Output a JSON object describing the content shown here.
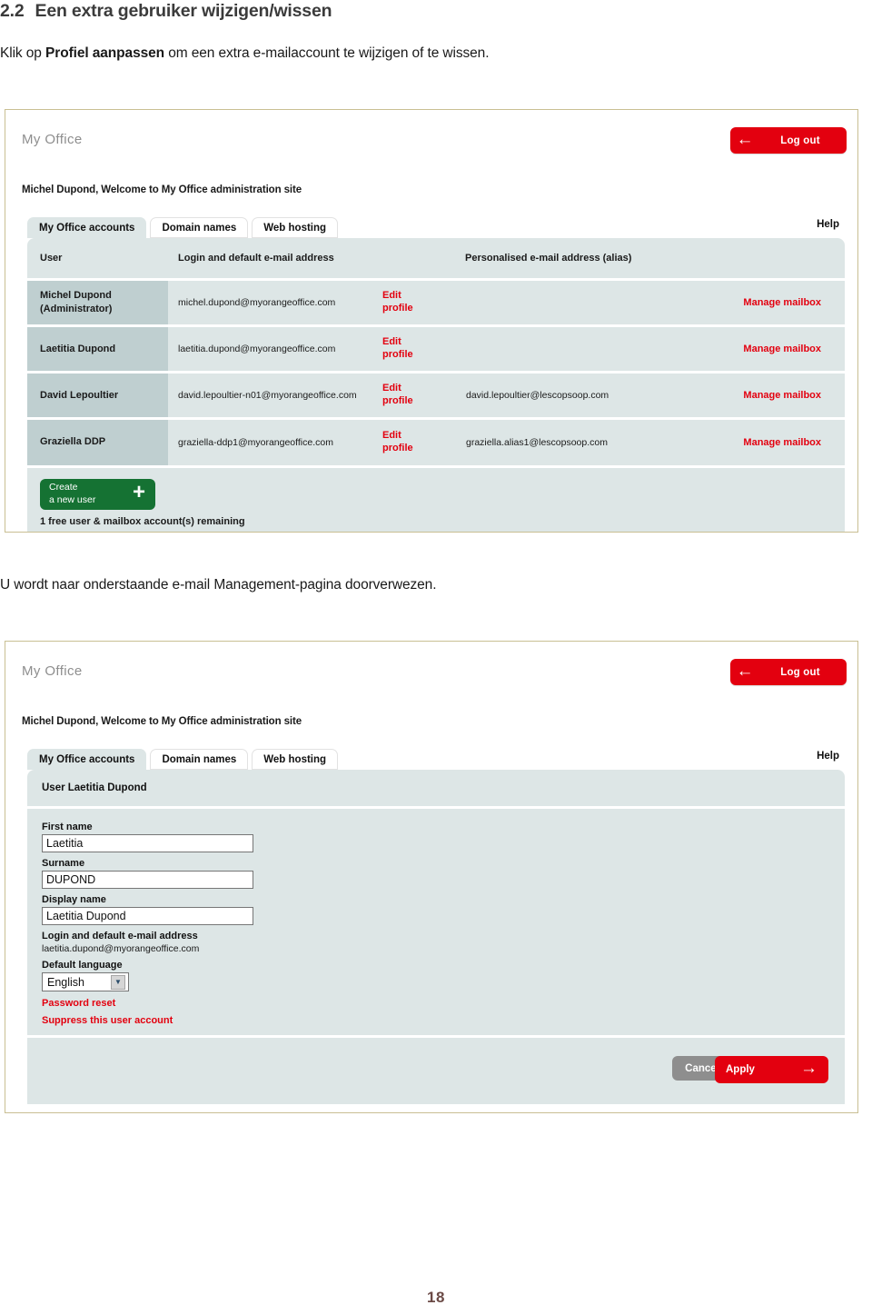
{
  "document": {
    "section_number": "2.2",
    "section_title": "Een extra gebruiker wijzigen/wissen",
    "intro_before": "Klik op ",
    "intro_bold": "Profiel aanpassen",
    "intro_after": " om een extra e-mailaccount te wijzigen of te wissen.",
    "middle_paragraph": "U wordt naar onderstaande e-mail Management-pagina doorverwezen.",
    "page_number": "18"
  },
  "screenshot_accounts": {
    "app_title": "My Office",
    "logout_label": "Log out",
    "logout_icon": "arrow-left-icon",
    "welcome": "Michel Dupond, Welcome to My Office administration site",
    "tabs": [
      {
        "label": "My Office accounts",
        "active": true
      },
      {
        "label": "Domain names",
        "active": false
      },
      {
        "label": "Web hosting",
        "active": false
      }
    ],
    "help_label": "Help",
    "table": {
      "headers": [
        "User",
        "Login and default e-mail address",
        "",
        "Personalised e-mail address (alias)",
        ""
      ],
      "rows": [
        {
          "user": "Michel Dupond\n(Administrator)",
          "login": "michel.dupond@myorangeoffice.com",
          "edit": "Edit\nprofile",
          "alias": "",
          "manage": "Manage mailbox"
        },
        {
          "user": "Laetitia Dupond",
          "login": "laetitia.dupond@myorangeoffice.com",
          "edit": "Edit\nprofile",
          "alias": "",
          "manage": "Manage mailbox"
        },
        {
          "user": "David Lepoultier",
          "login": "david.lepoultier-n01@myorangeoffice.com",
          "edit": "Edit\nprofile",
          "alias": "david.lepoultier@lescopsoop.com",
          "manage": "Manage mailbox"
        },
        {
          "user": "Graziella DDP",
          "login": "graziella-ddp1@myorangeoffice.com",
          "edit": "Edit\nprofile",
          "alias": "graziella.alias1@lescopsoop.com",
          "manage": "Manage mailbox"
        }
      ]
    },
    "create_button_label": "Create\na new user",
    "create_button_icon": "plus-icon",
    "free_note": "1 free user & mailbox account(s) remaining"
  },
  "screenshot_profile": {
    "app_title": "My Office",
    "logout_label": "Log out",
    "logout_icon": "arrow-left-icon",
    "welcome": "Michel Dupond, Welcome to My Office administration site",
    "tabs": [
      {
        "label": "My Office accounts",
        "active": true
      },
      {
        "label": "Domain names",
        "active": false
      },
      {
        "label": "Web hosting",
        "active": false
      }
    ],
    "help_label": "Help",
    "panel_header": "User Laetitia Dupond",
    "form": {
      "first_name_label": "First name",
      "first_name_value": "Laetitia",
      "surname_label": "Surname",
      "surname_value": "DUPOND",
      "display_name_label": "Display name",
      "display_name_value": "Laetitia Dupond",
      "login_label": "Login and default e-mail address",
      "login_value": "laetitia.dupond@myorangeoffice.com",
      "language_label": "Default language",
      "language_value": "English",
      "language_icon": "chevron-down-icon",
      "password_reset_label": "Password reset",
      "suppress_label": "Suppress this user account"
    },
    "cancel_label": "Cancel",
    "apply_label": "Apply",
    "apply_icon": "arrow-right-icon"
  },
  "colors": {
    "brand_red": "#e3000f",
    "panel_bg": "#dde6e6",
    "user_cell_bg": "#bfcfd0",
    "create_green": "#157233",
    "frame_border": "#c9bf93",
    "page_number": "#6b4a46"
  }
}
